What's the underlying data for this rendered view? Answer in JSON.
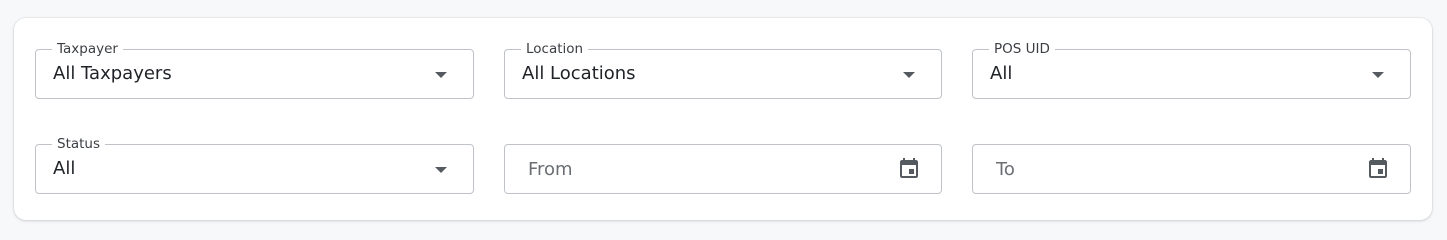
{
  "filters": {
    "taxpayer": {
      "label": "Taxpayer",
      "value": "All Taxpayers",
      "icon": "chevron-down-icon"
    },
    "location": {
      "label": "Location",
      "value": "All Locations",
      "icon": "chevron-down-icon"
    },
    "pos_uid": {
      "label": "POS UID",
      "value": "All",
      "icon": "chevron-down-icon"
    },
    "status": {
      "label": "Status",
      "value": "All",
      "icon": "chevron-down-icon"
    },
    "from": {
      "placeholder": "From",
      "icon": "calendar-icon"
    },
    "to": {
      "placeholder": "To",
      "icon": "calendar-icon"
    }
  },
  "colors": {
    "border": "#bfc3c8",
    "text": "#1f2226",
    "placeholder": "#6b6f74",
    "icon": "#555a60",
    "card": "#ffffff",
    "background": "#f7f8fa"
  }
}
